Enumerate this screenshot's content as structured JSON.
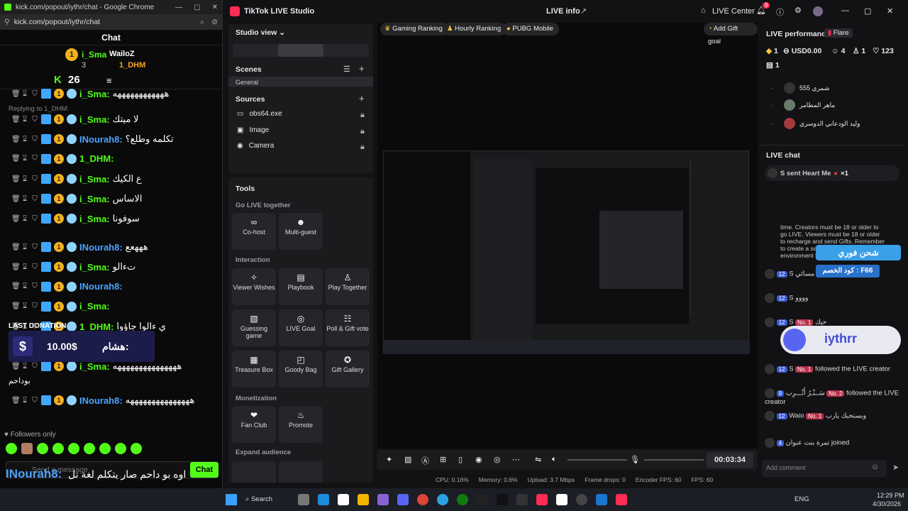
{
  "chrome": {
    "title": "kick.com/popout/iythr/chat - Google Chrome",
    "url": "kick.com/popout/iythr/chat",
    "chat_heading": "Chat",
    "leaderboard": {
      "first": "i_Sma",
      "second": "WailoZ",
      "third": "1_DHM",
      "rank_num": "3",
      "kick_count": "26"
    },
    "messages": [
      {
        "user": "i_Sma:",
        "text": "ههههههههههههه",
        "type": "green"
      },
      {
        "user": "i_Sma:",
        "text": "لا ميتك",
        "type": "green"
      },
      {
        "user": "INourah8:",
        "text": "تكلمه وطلع؟",
        "type": "blue"
      },
      {
        "user": "1_DHM:",
        "text": "",
        "type": "green"
      },
      {
        "user": "i_Sma:",
        "text": "ع الكيك",
        "type": "green"
      },
      {
        "user": "i_Sma:",
        "text": "الاساس",
        "type": "green"
      },
      {
        "user": "i_Sma:",
        "text": "سوفونا",
        "type": "green"
      },
      {
        "user": "INourah8:",
        "text": "هههعع",
        "type": "blue"
      },
      {
        "user": "i_Sma:",
        "text": "تءالو",
        "type": "green"
      },
      {
        "user": "INourah8:",
        "text": "",
        "type": "blue"
      },
      {
        "user": "i_Sma:",
        "text": "",
        "type": "green"
      },
      {
        "user": "1_DHM:",
        "text": "ي ءالوا جاؤوا",
        "type": "green"
      },
      {
        "user": "i_Sma:",
        "text": "هههههههههههههههه",
        "type": "green"
      },
      {
        "user": "INourah8:",
        "text": "هههههههههههههههه",
        "type": "blue"
      }
    ],
    "reply_1": "Replying to 1_DHM:",
    "reply_2": "Replying",
    "heart_count": "123",
    "last_donation_label": "LAST DONATION",
    "donation_name": "هشام:",
    "donation_amount": "10.00$",
    "bodahem": "بوداحم",
    "followers_only": "Followers only",
    "input_placeholder": "Send a message",
    "chat_button": "Chat",
    "overlay_user": "INourah8:",
    "overlay_text": "اوه بو داحم صار يتكلم لغة تل",
    "overlay_text2": "اوه بو داحم صار يتكلم لغة تل"
  },
  "studio": {
    "app_name": "TikTok LIVE Studio",
    "live_info": "LIVE info",
    "live_center": "LIVE Center",
    "notif_count": "9",
    "studio_view": "Studio view",
    "scenes": "Scenes",
    "scene_general": "General",
    "sources": "Sources",
    "source_items": [
      "obs64.exe",
      "Image",
      "Camera"
    ],
    "tools": "Tools",
    "go_live_together": "Go LIVE together",
    "interaction": "Interaction",
    "monetization": "Monetization",
    "expand_audience": "Expand audience",
    "tool_cohost": "Co-host",
    "tool_multiguest": "Multi-guest",
    "tool_viewer_wishes": "Viewer Wishes",
    "tool_playbook": "Playbook",
    "tool_play_together": "Play Together",
    "tool_guessing": "Guessing game",
    "tool_live_goal": "LIVE Goal",
    "tool_poll": "Poll & Gift vote",
    "tool_treasure": "Treasure Box",
    "tool_goody": "Goody Bag",
    "tool_gift_gallery": "Gift Gallery",
    "tool_fan_club": "Fan Club",
    "tool_promote": "Promote",
    "chips": [
      "Gaming Ranking",
      "Hourly Ranking",
      "PUBG Mobile"
    ],
    "add_gift_goal": "Add Gift goal",
    "timer": "00:03:34",
    "status": {
      "cpu": "CPU:  0.16%",
      "memory": "Memory:  0.6%",
      "upload": "Upload:  3.7 Mbps",
      "frame_drops": "Frame drops:  0",
      "encoder_fps": "Encoder FPS:  60",
      "fps": "FPS:  60"
    }
  },
  "performance": {
    "title": "LIVE performance",
    "flare": "Flare",
    "diamonds": "1",
    "usd": "USD0.00",
    "viewers": "4",
    "followers": "1",
    "likes": "123",
    "gifts": "1",
    "ranking": [
      {
        "name": "شمري 555"
      },
      {
        "name": "ماهر المطامر"
      },
      {
        "name": "وليد الودعاني الدوسري"
      }
    ],
    "live_chat": "LIVE chat",
    "heart_msg": "S sent Heart Me",
    "heart_x": "×1",
    "notice": "time. Creators must be 18 or older to go LIVE. Viewers must be 18 or older to recharge and send Gifts. Remember to create a safe and friendly environment for all followers.",
    "promo_1": "شحن فوري",
    "promo_2": "كود الخصم : F66",
    "discord_name": "iythrr",
    "discord_small": "iythr",
    "feed": [
      {
        "lvl": "12",
        "user": "S",
        "text": "مسائي"
      },
      {
        "lvl": "12",
        "user": "S",
        "text": "وووو"
      },
      {
        "lvl": "12",
        "user": "S",
        "rank": "No. 1",
        "text": "حيك"
      },
      {
        "lvl": "12",
        "user": "S",
        "rank": "No. 1",
        "text": "followed the LIVE creator"
      },
      {
        "lvl": "9",
        "user": "سَــنْـرُ أَنْـــرِب",
        "rank": "No. 2",
        "text": "followed the LIVE creator"
      },
      {
        "lvl": "12",
        "user": "Waio",
        "rank": "No. 1",
        "text": "وبسنحبك يارب"
      },
      {
        "lvl": "4",
        "user": "تمرة بنت عنوان",
        "text": "joined"
      }
    ],
    "add_comment": "Add comment"
  },
  "taskbar": {
    "search": "Search",
    "lang": "ENG",
    "time": "12:29 PM",
    "date": "4/30/2026"
  }
}
